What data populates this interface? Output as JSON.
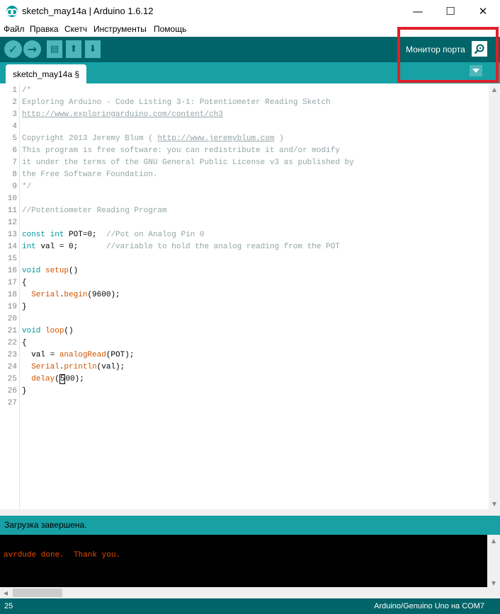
{
  "window": {
    "title": "sketch_may14a | Arduino 1.6.12",
    "minimize_glyph": "—",
    "maximize_glyph": "☐",
    "close_glyph": "✕"
  },
  "menu": [
    "Файл",
    "Правка",
    "Скетч",
    "Инструменты",
    "Помощь"
  ],
  "toolbar": {
    "verify_icon": "check-icon",
    "upload_icon": "arrow-right-icon",
    "new_icon": "new-file-icon",
    "open_icon": "arrow-up-icon",
    "save_icon": "arrow-down-icon",
    "serial_monitor_label": "Монитор порта",
    "serial_monitor_icon": "magnifier-icon"
  },
  "tab": {
    "label": "sketch_may14a §"
  },
  "editor": {
    "lines": [
      "/*",
      "Exploring Arduino - Code Listing 3-1: Potentiometer Reading Sketch",
      "http://www.exploringarduino.com/content/ch3",
      "",
      "Copyright 2013 Jeremy Blum ( http://www.jeremyblum.com )",
      "This program is free software: you can redistribute it and/or modify",
      "it under the terms of the GNU General Public License v3 as published by",
      "the Free Software Foundation.",
      "*/",
      "",
      "//Potentiometer Reading Program",
      "",
      "const int POT=0;  //Pot on Analog Pin 0",
      "int val = 0;      //variable to hold the analog reading from the POT",
      "",
      "void setup()",
      "{",
      "  Serial.begin(9600);",
      "}",
      "",
      "void loop()",
      "{",
      "  val = analogRead(POT);",
      "  Serial.println(val);",
      "  delay(500);",
      "}",
      ""
    ]
  },
  "status": {
    "message": "Загрузка завершена."
  },
  "console": {
    "output": "avrdude done.  Thank you."
  },
  "bottom": {
    "line": "25",
    "board": "Arduino/Genuino Uno на COM7"
  },
  "colors": {
    "toolbar_bg": "#006468",
    "accent": "#17a1a5",
    "button_bg": "#4db7bb",
    "highlight": "#e0202a",
    "keyword": "#00979c",
    "function": "#d35400",
    "comment": "#95a5a6",
    "console_text": "#e34c00"
  }
}
